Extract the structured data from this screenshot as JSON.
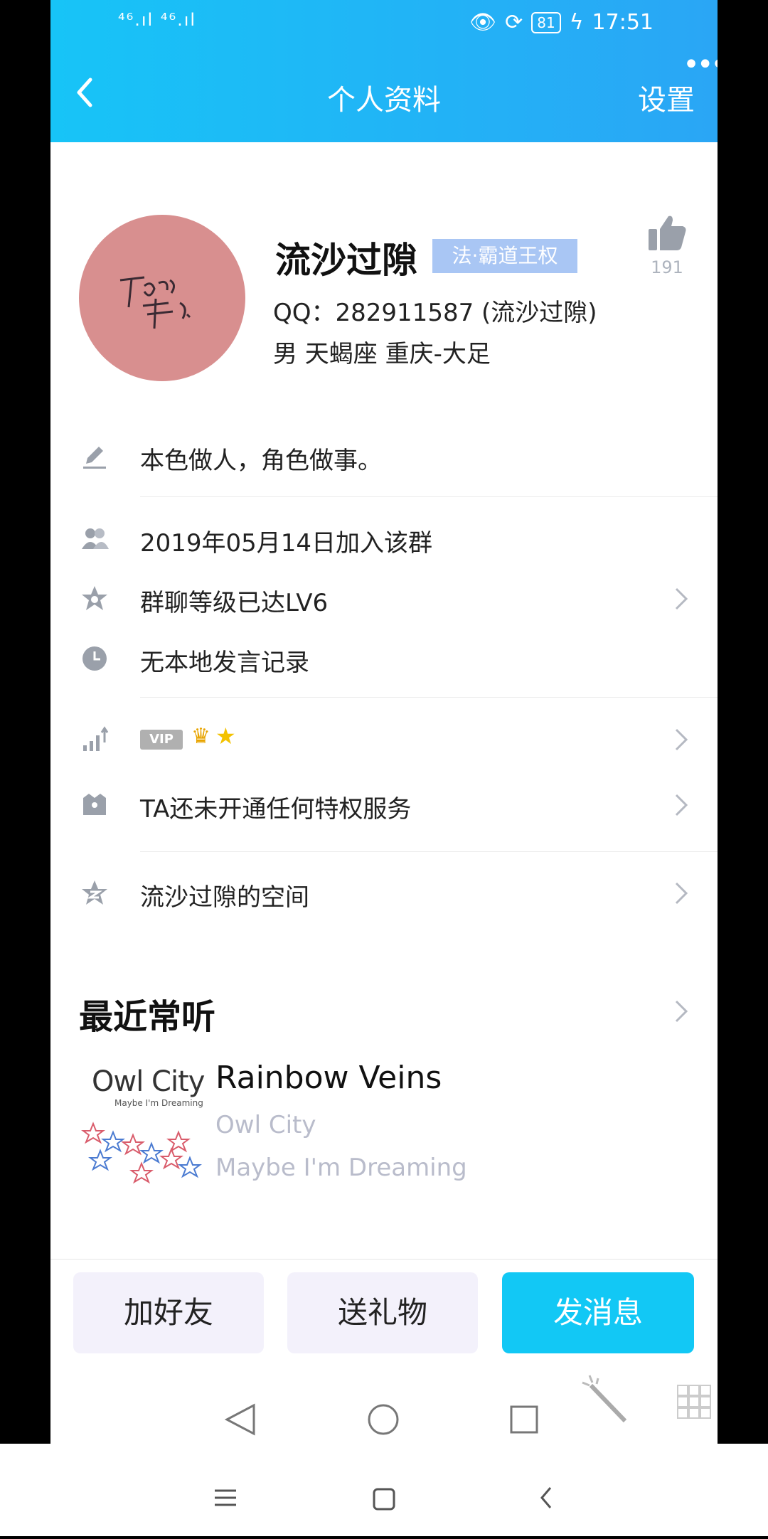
{
  "status": {
    "signal_text": "⁴⁶.ıl ⁴⁶.ıl",
    "battery": "81",
    "time": "17:51"
  },
  "header": {
    "title": "个人资料",
    "settings_label": "设置",
    "more_label": "•••"
  },
  "profile": {
    "name": "流沙过隙",
    "badge": "法·霸道王权",
    "likes": "191",
    "qq_line": "QQ：282911587 (流沙过隙)",
    "info_line": "男  天蝎座  重庆-大足"
  },
  "rows": [
    {
      "text": "本色做人，角色做事。"
    },
    {
      "text": "2019年05月14日加入该群"
    },
    {
      "text": "群聊等级已达LV6"
    },
    {
      "text": "无本地发言记录"
    },
    {
      "text": ""
    },
    {
      "text": "TA还未开通任何特权服务"
    },
    {
      "text": "流沙过隙的空间"
    }
  ],
  "vip": {
    "label": "VIP",
    "icons": [
      "crown-icon",
      "star-icon"
    ]
  },
  "music": {
    "section_title": "最近常听",
    "song": "Rainbow Veins",
    "artist": "Owl City",
    "album": "Maybe I'm Dreaming",
    "album_brand": "Owl City",
    "album_sub": "Maybe I'm Dreaming"
  },
  "actions": {
    "add_friend": "加好友",
    "send_gift": "送礼物",
    "send_message": "发消息"
  },
  "colors": {
    "accent": "#12c8f5",
    "header": "#1fb6f6",
    "button_bg": "#f3f1fb",
    "muted": "#b9bccb"
  }
}
